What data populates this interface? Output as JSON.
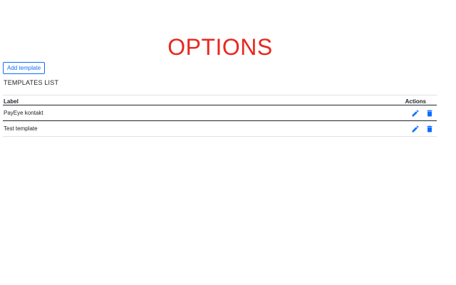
{
  "page": {
    "title": "OPTIONS"
  },
  "toolbar": {
    "add_label": "Add template"
  },
  "templates": {
    "section_title": "TEMPLATES LIST",
    "columns": {
      "label": "Label",
      "actions": "Actions"
    },
    "rows": [
      {
        "label": "PayEye kontakt"
      },
      {
        "label": "Test template"
      }
    ]
  },
  "icons": {
    "edit": "pencil-icon",
    "delete": "trash-icon"
  },
  "colors": {
    "title": "#e8281f",
    "accent": "#0d6efd"
  }
}
